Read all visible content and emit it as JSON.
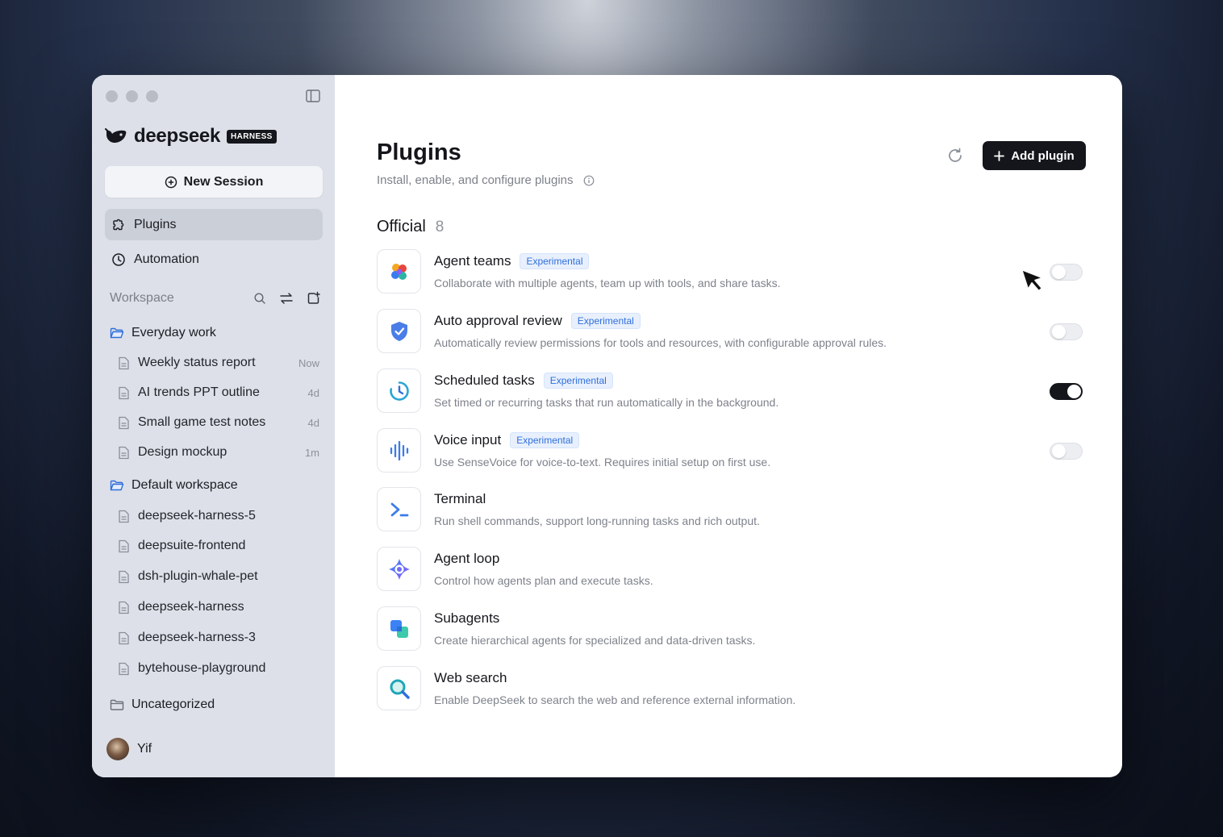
{
  "sidebar": {
    "logo_text": "deepseek",
    "logo_badge": "HARNESS",
    "new_session_label": "New Session",
    "nav": [
      {
        "label": "Plugins",
        "icon": "puzzle-icon",
        "active": true
      },
      {
        "label": "Automation",
        "icon": "clock-icon",
        "active": false
      }
    ],
    "workspace_title": "Workspace",
    "folders": [
      {
        "name": "Everyday work",
        "items": [
          {
            "name": "Weekly status report",
            "time": "Now"
          },
          {
            "name": "AI trends PPT outline",
            "time": "4d"
          },
          {
            "name": "Small game test notes",
            "time": "4d"
          },
          {
            "name": "Design mockup",
            "time": "1m"
          }
        ]
      },
      {
        "name": "Default workspace",
        "items": [
          {
            "name": "deepseek-harness-5"
          },
          {
            "name": "deepsuite-frontend"
          },
          {
            "name": "dsh-plugin-whale-pet"
          },
          {
            "name": "deepseek-harness"
          },
          {
            "name": "deepseek-harness-3"
          },
          {
            "name": "bytehouse-playground"
          }
        ]
      },
      {
        "name": "Uncategorized",
        "items": []
      }
    ],
    "user_name": "Yif"
  },
  "header": {
    "title": "Plugins",
    "subtitle": "Install, enable, and configure plugins",
    "add_plugin_label": "Add plugin"
  },
  "section": {
    "title": "Official",
    "count": "8"
  },
  "plugins": [
    {
      "name": "Agent teams",
      "badge": "Experimental",
      "desc": "Collaborate with multiple agents, team up with tools, and share tasks.",
      "icon": "agent-teams-icon",
      "toggle": "off"
    },
    {
      "name": "Auto approval review",
      "badge": "Experimental",
      "desc": "Automatically review permissions for tools and resources, with configurable approval rules.",
      "icon": "shield-check-icon",
      "toggle": "off"
    },
    {
      "name": "Scheduled tasks",
      "badge": "Experimental",
      "desc": "Set timed or recurring tasks that run automatically in the background.",
      "icon": "timer-icon",
      "toggle": "on"
    },
    {
      "name": "Voice input",
      "badge": "Experimental",
      "desc": "Use SenseVoice for voice-to-text. Requires initial setup on first use.",
      "icon": "waveform-icon",
      "toggle": "off"
    },
    {
      "name": "Terminal",
      "badge": "",
      "desc": "Run shell commands, support long-running tasks and rich output.",
      "icon": "terminal-icon",
      "toggle": "none"
    },
    {
      "name": "Agent loop",
      "badge": "",
      "desc": "Control how agents plan and execute tasks.",
      "icon": "agent-loop-icon",
      "toggle": "none"
    },
    {
      "name": "Subagents",
      "badge": "",
      "desc": "Create hierarchical agents for specialized and data-driven tasks.",
      "icon": "subagents-icon",
      "toggle": "none"
    },
    {
      "name": "Web search",
      "badge": "",
      "desc": "Enable DeepSeek to search the web and reference external information.",
      "icon": "magnifier-icon",
      "toggle": "none"
    }
  ],
  "colors": {
    "accent": "#14161b",
    "badge_text": "#2f6fdc",
    "sidebar_bg": "#dde0e8"
  }
}
